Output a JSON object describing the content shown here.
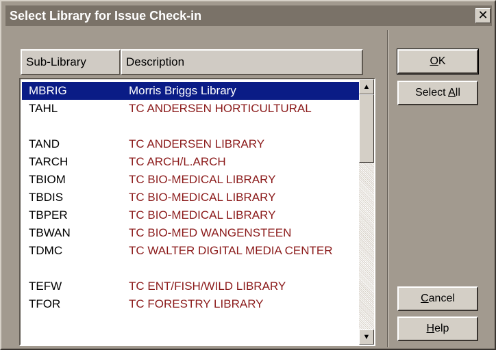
{
  "window": {
    "title": "Select Library for Issue Check-in",
    "close_symbol": "✕"
  },
  "columns": {
    "sub_library": "Sub-Library",
    "description": "Description"
  },
  "rows": [
    {
      "code": "MBRIG",
      "description": "Morris Briggs Library",
      "selected": true
    },
    {
      "code": "TAHL",
      "description": "TC ANDERSEN HORTICULTURAL",
      "tall": true
    },
    {
      "code": "TAND",
      "description": "TC ANDERSEN LIBRARY"
    },
    {
      "code": "TARCH",
      "description": "TC ARCH/L.ARCH"
    },
    {
      "code": "TBIOM",
      "description": "TC BIO-MEDICAL LIBRARY"
    },
    {
      "code": "TBDIS",
      "description": "TC BIO-MEDICAL LIBRARY"
    },
    {
      "code": "TBPER",
      "description": "TC BIO-MEDICAL LIBRARY"
    },
    {
      "code": "TBWAN",
      "description": "TC BIO-MED WANGENSTEEN"
    },
    {
      "code": "TDMC",
      "description": "TC WALTER DIGITAL MEDIA CENTER",
      "tall": true
    },
    {
      "code": "TEFW",
      "description": "TC ENT/FISH/WILD LIBRARY"
    },
    {
      "code": "TFOR",
      "description": "TC FORESTRY LIBRARY"
    }
  ],
  "buttons": {
    "ok": {
      "mnemonic": "O",
      "rest": "K"
    },
    "select_all": {
      "before": "Select ",
      "mnemonic": "A",
      "rest": "ll"
    },
    "cancel": {
      "mnemonic": "C",
      "rest": "ancel"
    },
    "help": {
      "mnemonic": "H",
      "rest": "elp"
    }
  },
  "scrollbar": {
    "up_arrow": "▲",
    "down_arrow": "▼"
  },
  "colors": {
    "selection": "#0a1c86",
    "description_text": "#8b1a1a",
    "dialog_face": "#a29a8f"
  }
}
